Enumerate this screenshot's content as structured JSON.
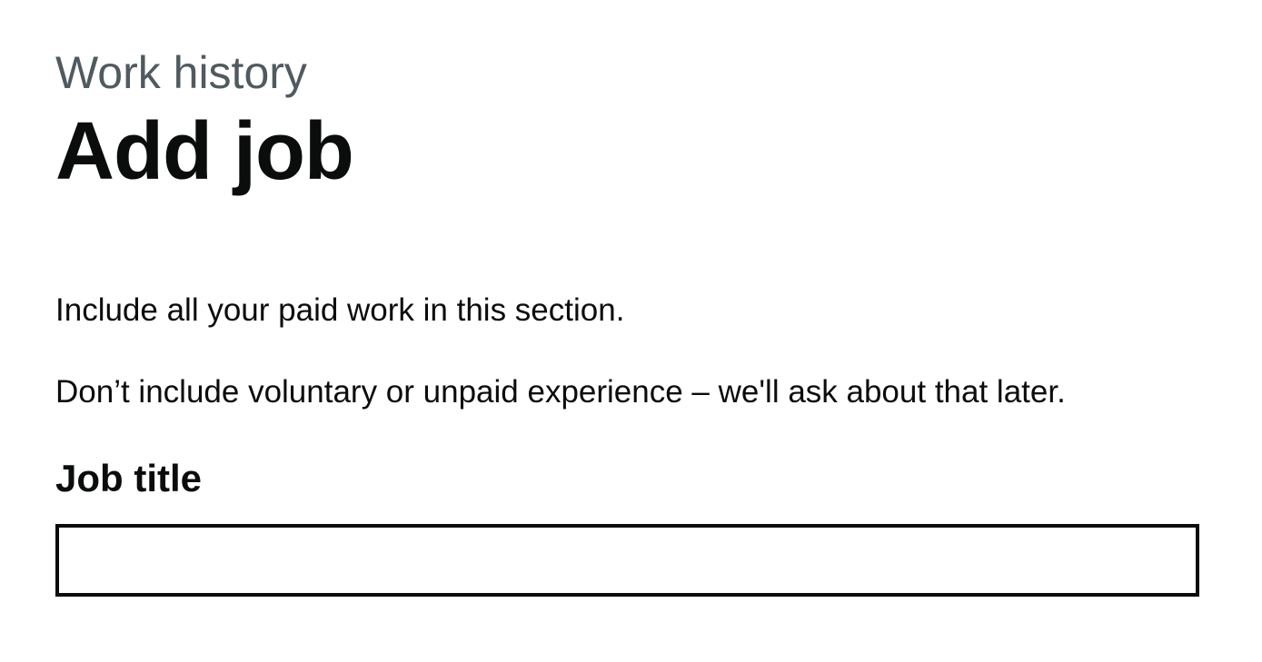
{
  "header": {
    "caption": "Work history",
    "title": "Add job"
  },
  "body": {
    "paragraphs": [
      "Include all your paid work in this section.",
      "Don’t include voluntary or unpaid experience – we'll ask about that later."
    ]
  },
  "form": {
    "job_title": {
      "label": "Job title",
      "value": ""
    }
  }
}
